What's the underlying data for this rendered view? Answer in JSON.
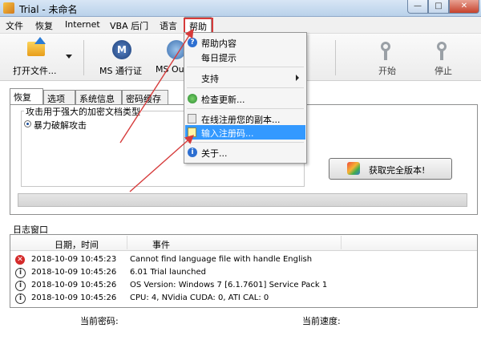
{
  "window": {
    "title": "Trial - 未命名",
    "min_glyph": "—",
    "max_glyph": "□",
    "close_glyph": "✕"
  },
  "menubar": {
    "items": [
      "文件",
      "恢复",
      "Internet",
      "VBA 后门",
      "语言",
      "帮助"
    ]
  },
  "toolbar": {
    "open_label": "打开文件...",
    "ms_pass_label": "MS 通行证",
    "ms_out_label": "MS Out",
    "ms_icon_letter": "M",
    "start_label": "开始",
    "stop_label": "停止"
  },
  "help_menu": {
    "items": [
      "帮助内容",
      "每日提示",
      "支持",
      "检查更新...",
      "在线注册您的副本...",
      "输入注册码...",
      "关于..."
    ]
  },
  "tabs": [
    "恢复",
    "选项",
    "系统信息",
    "密码缓存"
  ],
  "attack": {
    "group_label": "攻击用于强大的加密文档类型",
    "option_label": "暴力破解攻击"
  },
  "buy_button": {
    "label": "获取完全版本!"
  },
  "log": {
    "title": "日志窗口",
    "columns": [
      "日期，时间",
      "事件"
    ],
    "rows": [
      {
        "time": "2018-10-09 10:45:23",
        "event": "Cannot find language file with handle English",
        "level": "error"
      },
      {
        "time": "2018-10-09 10:45:26",
        "event": "6.01 Trial launched",
        "level": "info"
      },
      {
        "time": "2018-10-09 10:45:26",
        "event": "OS Version: Windows 7 [6.1.7601] Service Pack 1",
        "level": "info"
      },
      {
        "time": "2018-10-09 10:45:26",
        "event": "CPU: 4, NVidia CUDA: 0, ATI CAL: 0",
        "level": "info"
      }
    ]
  },
  "status": {
    "current_password_label": "当前密码:",
    "current_speed_label": "当前速度:"
  },
  "colors": {
    "highlight": "#3399ff",
    "annotation_red": "#d63b3b"
  }
}
